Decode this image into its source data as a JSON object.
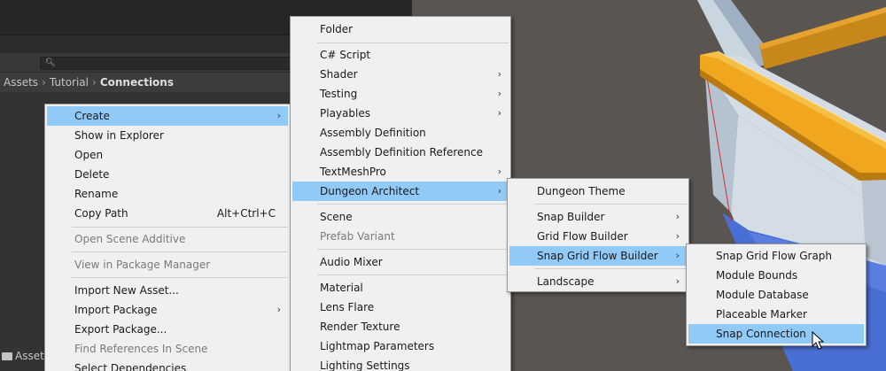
{
  "project_window": {
    "breadcrumb": [
      "Assets",
      "Tutorial",
      "Connections"
    ],
    "search_placeholder": "",
    "bottom_tab": "Asset"
  },
  "context_menu": {
    "items": [
      {
        "label": "Create",
        "submenu": true,
        "highlighted": true
      },
      {
        "label": "Show in Explorer"
      },
      {
        "label": "Open"
      },
      {
        "label": "Delete"
      },
      {
        "label": "Rename"
      },
      {
        "label": "Copy Path",
        "shortcut": "Alt+Ctrl+C"
      },
      {
        "label": "Open Scene Additive",
        "disabled": true
      },
      {
        "label": "View in Package Manager",
        "disabled": true
      },
      {
        "label": "Import New Asset..."
      },
      {
        "label": "Import Package",
        "submenu": true
      },
      {
        "label": "Export Package..."
      },
      {
        "label": "Find References In Scene",
        "disabled": true
      },
      {
        "label": "Select Dependencies"
      }
    ]
  },
  "create_menu": {
    "items": [
      {
        "label": "Folder"
      },
      {
        "label": "C# Script"
      },
      {
        "label": "Shader",
        "submenu": true
      },
      {
        "label": "Testing",
        "submenu": true
      },
      {
        "label": "Playables",
        "submenu": true
      },
      {
        "label": "Assembly Definition"
      },
      {
        "label": "Assembly Definition Reference"
      },
      {
        "label": "TextMeshPro",
        "submenu": true
      },
      {
        "label": "Dungeon Architect",
        "submenu": true,
        "highlighted": true
      },
      {
        "label": "Scene"
      },
      {
        "label": "Prefab Variant",
        "disabled": true
      },
      {
        "label": "Audio Mixer"
      },
      {
        "label": "Material"
      },
      {
        "label": "Lens Flare"
      },
      {
        "label": "Render Texture"
      },
      {
        "label": "Lightmap Parameters"
      },
      {
        "label": "Lighting Settings"
      }
    ]
  },
  "dungeon_architect_menu": {
    "items": [
      {
        "label": "Dungeon Theme"
      },
      {
        "label": "Snap Builder",
        "submenu": true
      },
      {
        "label": "Grid Flow Builder",
        "submenu": true
      },
      {
        "label": "Snap Grid Flow Builder",
        "submenu": true,
        "highlighted": true
      },
      {
        "label": "Landscape",
        "submenu": true
      }
    ]
  },
  "snap_grid_flow_menu": {
    "items": [
      {
        "label": "Snap Grid Flow Graph"
      },
      {
        "label": "Module Bounds"
      },
      {
        "label": "Module Database"
      },
      {
        "label": "Placeable Marker"
      },
      {
        "label": "Snap Connection",
        "highlighted": true
      }
    ]
  },
  "icons": {
    "submenu_arrow": "chevron-right-icon",
    "search": "search-icon",
    "cursor": "mouse-pointer-icon"
  },
  "colors": {
    "menu_bg": "#f0f0f0",
    "highlight": "#91c9f7",
    "editor_bg": "#383838",
    "scene_floor": "#5b5551",
    "beam_orange": "#f0a61e",
    "wall_light": "#d2dbe3",
    "floor_blue": "#4a6fd4"
  }
}
